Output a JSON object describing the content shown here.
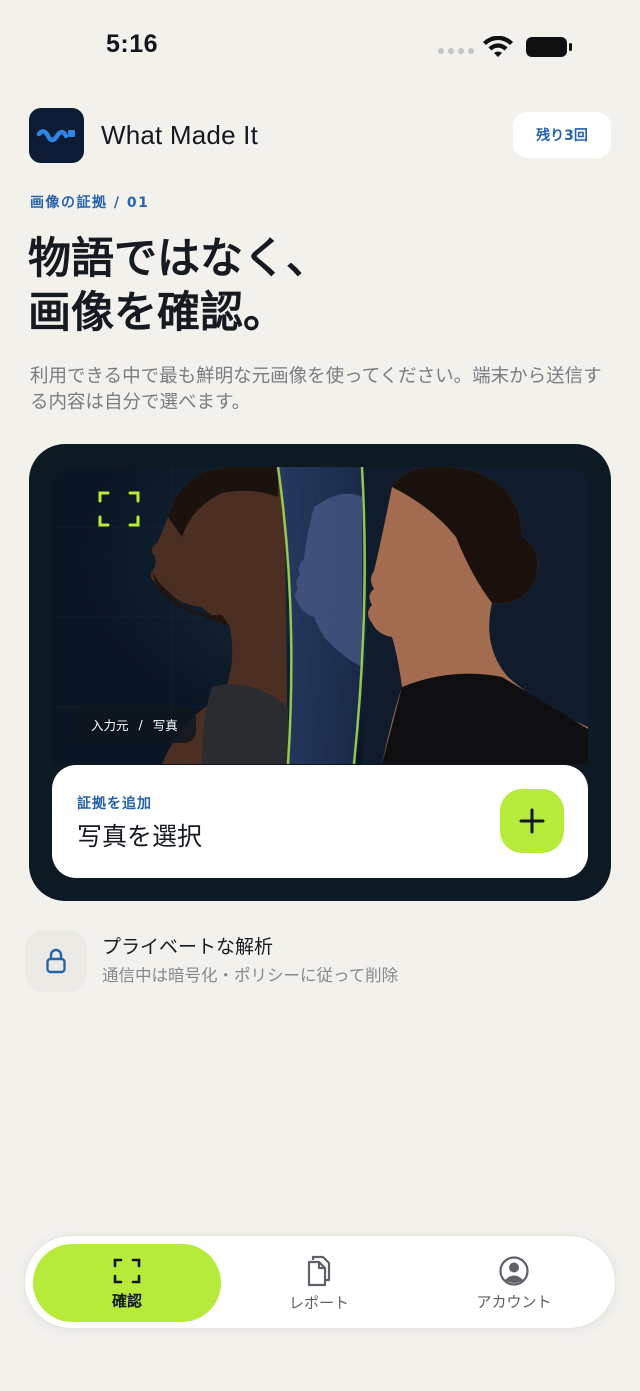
{
  "status_bar": {
    "time": "5:16"
  },
  "header": {
    "app_name": "What Made It",
    "credits": "残り3回"
  },
  "section": {
    "label": "画像の証拠 / 01"
  },
  "headline": {
    "line1": "物語ではなく、",
    "line2": "画像を確認。"
  },
  "description": "利用できる中で最も鮮明な元画像を使ってください。端末から送信する内容は自分で選べます。",
  "evidence": {
    "source_tag": {
      "left": "入力元",
      "separator": "/",
      "right": "写真"
    },
    "add_label": "証拠を追加",
    "add_title": "写真を選択"
  },
  "privacy": {
    "title": "プライベートな解析",
    "subtitle": "通信中は暗号化・ポリシーに従って削除"
  },
  "tabs": [
    {
      "label": "確認",
      "icon": "scan-icon",
      "active": true
    },
    {
      "label": "レポート",
      "icon": "documents-icon",
      "active": false
    },
    {
      "label": "アカウント",
      "icon": "account-icon",
      "active": false
    }
  ],
  "colors": {
    "accent": "#b6eb3b",
    "brand_blue": "#2762ad",
    "card_dark": "#0e1a23",
    "background": "#f3f1ec"
  }
}
